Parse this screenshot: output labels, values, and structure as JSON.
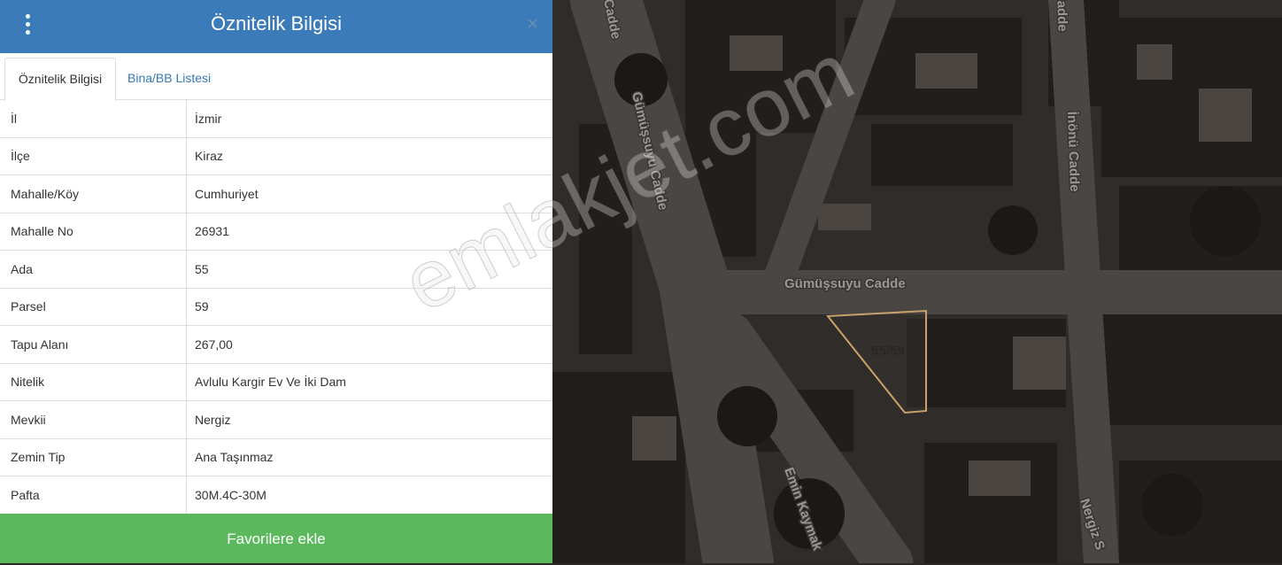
{
  "panel": {
    "title": "Öznitelik Bilgisi",
    "close_symbol": "×",
    "tabs": [
      {
        "label": "Öznitelik Bilgisi",
        "active": true
      },
      {
        "label": "Bina/BB Listesi",
        "active": false
      }
    ],
    "rows": [
      {
        "key": "İl",
        "value": "İzmir"
      },
      {
        "key": "İlçe",
        "value": "Kiraz"
      },
      {
        "key": "Mahalle/Köy",
        "value": "Cumhuriyet"
      },
      {
        "key": "Mahalle No",
        "value": "26931"
      },
      {
        "key": "Ada",
        "value": "55"
      },
      {
        "key": "Parsel",
        "value": "59"
      },
      {
        "key": "Tapu Alanı",
        "value": "267,00"
      },
      {
        "key": "Nitelik",
        "value": "Avlulu Kargir Ev Ve İki Dam"
      },
      {
        "key": "Mevkii",
        "value": "Nergiz"
      },
      {
        "key": "Zemin Tip",
        "value": "Ana Taşınmaz"
      },
      {
        "key": "Pafta",
        "value": "30M.4C-30M"
      }
    ],
    "favorite_button": "Favorilere ekle"
  },
  "map": {
    "streets": {
      "gumussuyu_vertical": "Gümüşsuyu Cadde",
      "gumussuyu_horizontal": "Gümüşsuyu Cadde",
      "inonu": "İnönü Cadde",
      "top_left": "Cadde",
      "top_right": "Cadde",
      "emin_kaymak": "Emin Kaymak",
      "nergiz": "Nergiz S"
    },
    "parcel_label": "55/59"
  },
  "watermark": "emlakjet.com",
  "colors": {
    "header": "#3c7bba",
    "button": "#5cb85c",
    "tab_link": "#337ab7",
    "parcel_outline": "#c9a26b"
  },
  "icons": {
    "menu": "kebab-menu-icon",
    "close": "close-icon"
  }
}
